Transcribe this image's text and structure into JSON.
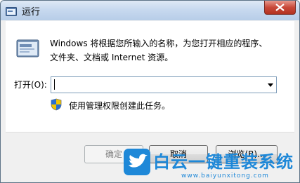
{
  "window": {
    "title": "运行"
  },
  "content": {
    "description_line1": "Windows 将根据您所输入的名称，为您打开相应的程序、",
    "description_line2": "文件夹、文档或 Internet 资源。",
    "open_label": "打开(O):",
    "open_value": "",
    "admin_note": "使用管理权限创建此任务。"
  },
  "buttons": {
    "ok": "确定",
    "cancel": "取消",
    "browse": "浏览(B)..."
  },
  "watermark": {
    "title": "白云一键重装系统",
    "url": "www.baiyunxitong.com"
  },
  "colors": {
    "titlebar": "#c7d9ef",
    "close": "#c8493a",
    "watermark": "#1e88d8"
  },
  "icons": [
    "run-icon",
    "close-icon",
    "dropdown-arrow-icon",
    "uac-shield-icon",
    "bird-logo-icon"
  ]
}
